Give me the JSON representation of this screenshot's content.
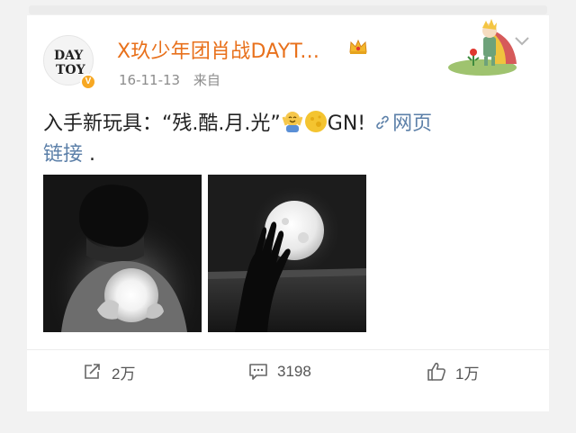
{
  "post": {
    "username": "X玖少年团肖战DAYT...",
    "timestamp": "16-11-13",
    "source": "来自",
    "text_main": "入手新玩具：“残.酷.月.光”",
    "text_gn": "GN!",
    "link_label": "网页",
    "link_label_2": "链接",
    "text_tail": " .",
    "avatar_logo_line1": "DAY",
    "avatar_logo_line2": "TOY",
    "verified_badge": "V"
  },
  "actions": {
    "repost_count": "2万",
    "comment_count": "3198",
    "like_count": "1万"
  },
  "icons": {
    "repost": "repost-icon",
    "comment": "comment-icon",
    "like": "thumbs-up-icon",
    "link": "link-icon",
    "crown": "crown-icon",
    "chevron": "chevron-down-icon"
  },
  "colors": {
    "username": "#e8711c",
    "link": "#5b7fa8",
    "badge": "#f7a823"
  }
}
